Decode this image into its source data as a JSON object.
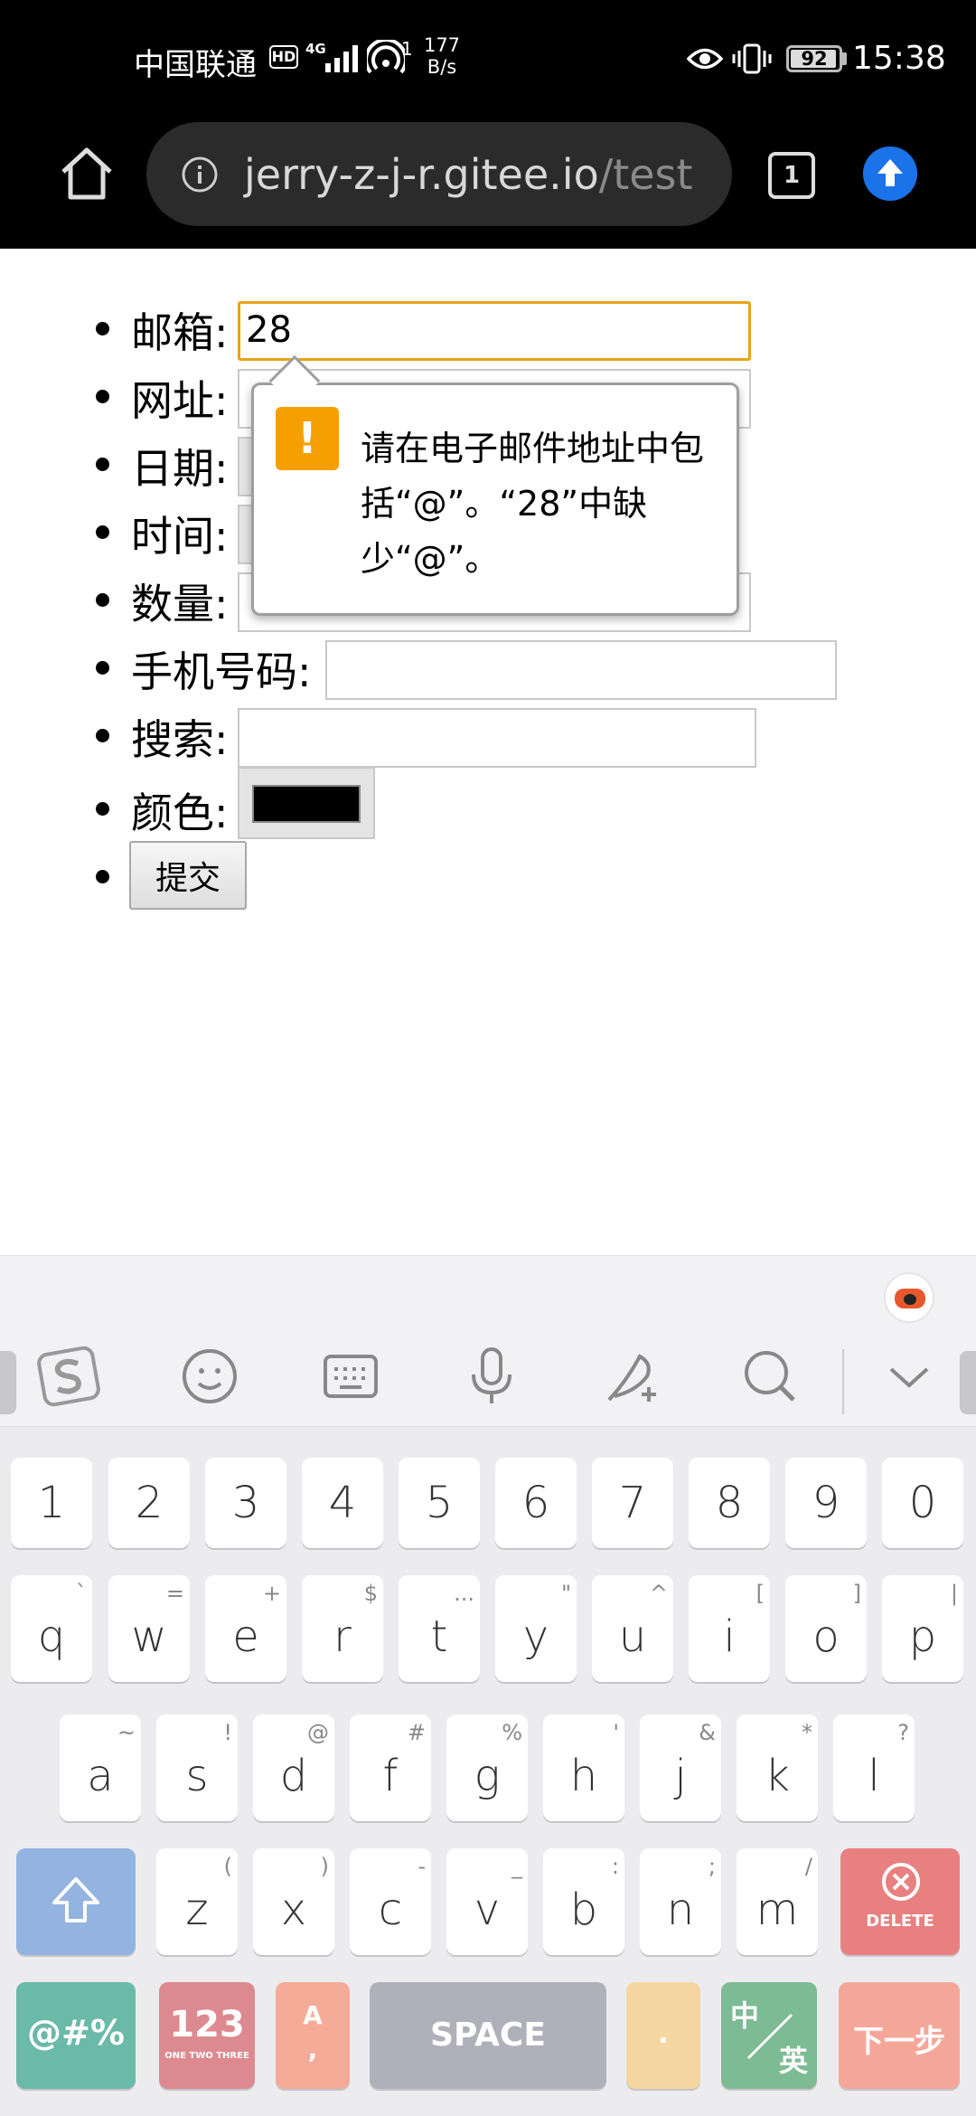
{
  "status_bar": {
    "carrier": "中国联通",
    "hd": "HD",
    "network_type": "4G",
    "wifi_badge": "1",
    "speed_value": "177",
    "speed_unit": "B/s",
    "battery": "92",
    "time": "15:38"
  },
  "browser": {
    "url_host": "jerry-z-j-r.gitee.io",
    "url_path": "/test",
    "tab_count": "1"
  },
  "form": {
    "fields": [
      {
        "label": "邮箱:",
        "value": "28"
      },
      {
        "label": "网址:",
        "value": ""
      },
      {
        "label": "日期:",
        "value": ""
      },
      {
        "label": "时间:",
        "value": ""
      },
      {
        "label": "数量:",
        "value": ""
      },
      {
        "label": "手机号码:",
        "value": ""
      },
      {
        "label": "搜索:",
        "value": ""
      },
      {
        "label": "颜色:",
        "value": "#000000"
      }
    ],
    "submit_label": "提交"
  },
  "validation_popup": {
    "icon": "!",
    "message": "请在电子邮件地址中包括“@”。“28”中缺少“@”。"
  },
  "keyboard": {
    "toolbar_icons": [
      "sogou-logo-icon",
      "emoji-icon",
      "keyboard-icon",
      "microphone-icon",
      "handwriting-icon",
      "search-icon",
      "collapse-icon"
    ],
    "number_row": [
      "1",
      "2",
      "3",
      "4",
      "5",
      "6",
      "7",
      "8",
      "9",
      "0"
    ],
    "row1": [
      {
        "main": "q",
        "sub": "`"
      },
      {
        "main": "w",
        "sub": "="
      },
      {
        "main": "e",
        "sub": "+"
      },
      {
        "main": "r",
        "sub": "$"
      },
      {
        "main": "t",
        "sub": "..."
      },
      {
        "main": "y",
        "sub": "\""
      },
      {
        "main": "u",
        "sub": "^"
      },
      {
        "main": "i",
        "sub": "["
      },
      {
        "main": "o",
        "sub": "]"
      },
      {
        "main": "p",
        "sub": "|"
      }
    ],
    "row2": [
      {
        "main": "a",
        "sub": "~"
      },
      {
        "main": "s",
        "sub": "!"
      },
      {
        "main": "d",
        "sub": "@"
      },
      {
        "main": "f",
        "sub": "#"
      },
      {
        "main": "g",
        "sub": "%"
      },
      {
        "main": "h",
        "sub": "'"
      },
      {
        "main": "j",
        "sub": "&"
      },
      {
        "main": "k",
        "sub": "*"
      },
      {
        "main": "l",
        "sub": "?"
      }
    ],
    "row3": [
      {
        "main": "z",
        "sub": "("
      },
      {
        "main": "x",
        "sub": ")"
      },
      {
        "main": "c",
        "sub": "-"
      },
      {
        "main": "v",
        "sub": "_"
      },
      {
        "main": "b",
        "sub": ":"
      },
      {
        "main": "n",
        "sub": ";"
      },
      {
        "main": "m",
        "sub": "/"
      }
    ],
    "delete_label": "DELETE",
    "symbol_label": "@#%",
    "num_label": "123",
    "num_sub_label": "ONE TWO THREE",
    "lang_zh_label": "A",
    "lang_zh_sub": ",",
    "space_label": "SPACE",
    "dot_label": ".",
    "cn_en_top": "中",
    "cn_en_bottom": "英",
    "next_label": "下一步",
    "colors": {
      "shift": "#93b3e0",
      "delete": "#e88080",
      "symbol": "#6bb9a8",
      "num": "#dc8a8f",
      "space": "#b0b0ba",
      "next": "#f4a799"
    }
  }
}
